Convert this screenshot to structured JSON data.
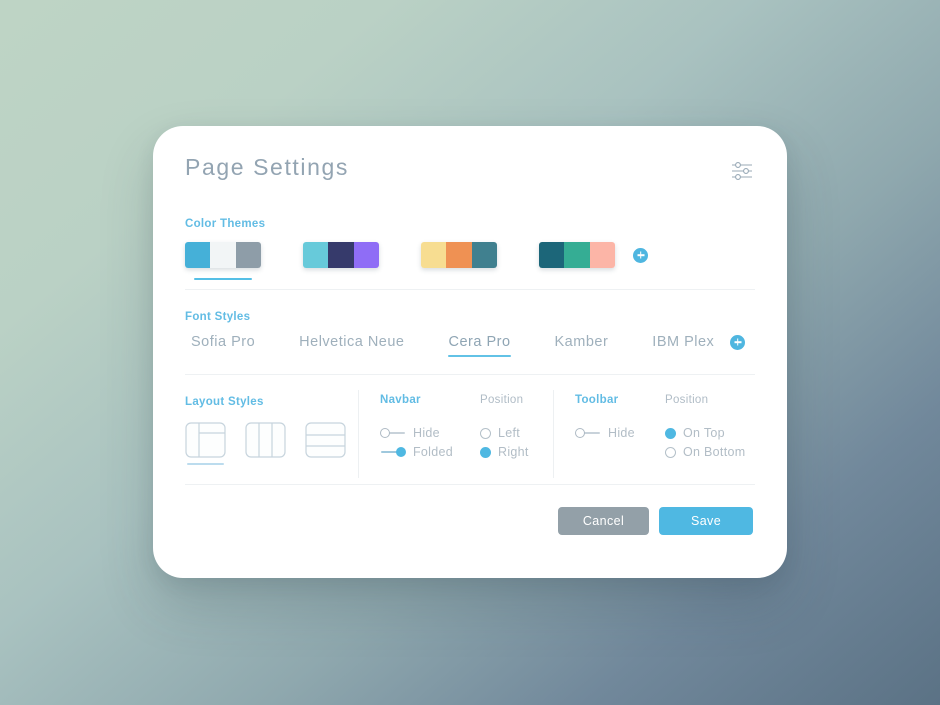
{
  "header": {
    "title": "Page Settings",
    "settings_icon": "sliders-icon"
  },
  "color_themes": {
    "label": "Color Themes",
    "add_label": "+",
    "selected_index": 0,
    "themes": [
      {
        "name": "theme-1",
        "colors": [
          "#45b0d8",
          "#f2f5f6",
          "#8e9da8"
        ]
      },
      {
        "name": "theme-2",
        "colors": [
          "#67cada",
          "#363a6b",
          "#8f6df6"
        ]
      },
      {
        "name": "theme-3",
        "colors": [
          "#f7dd91",
          "#ef9153",
          "#40808f"
        ]
      },
      {
        "name": "theme-4",
        "colors": [
          "#1c6679",
          "#35ad94",
          "#fcb5a7"
        ]
      }
    ]
  },
  "font_styles": {
    "label": "Font Styles",
    "add_label": "+",
    "selected": "Cera Pro",
    "fonts": [
      "Sofia Pro",
      "Helvetica Neue",
      "Cera Pro",
      "Kamber",
      "IBM Plex"
    ]
  },
  "layout_styles": {
    "label": "Layout Styles",
    "selected_index": 0,
    "options": [
      "sidebar-header-layout",
      "three-column-layout",
      "three-row-layout"
    ]
  },
  "navbar": {
    "title": "Navbar",
    "options": [
      {
        "label": "Hide",
        "on": false
      },
      {
        "label": "Folded",
        "on": true
      }
    ],
    "position": {
      "title": "Position",
      "options": [
        {
          "label": "Left",
          "on": false
        },
        {
          "label": "Right",
          "on": true
        }
      ]
    }
  },
  "toolbar": {
    "title": "Toolbar",
    "options": [
      {
        "label": "Hide",
        "on": false
      }
    ],
    "position": {
      "title": "Position",
      "options": [
        {
          "label": "On Top",
          "on": true
        },
        {
          "label": "On Bottom",
          "on": false
        }
      ]
    }
  },
  "footer": {
    "cancel_label": "Cancel",
    "save_label": "Save"
  },
  "colors": {
    "accent": "#4fb8e2",
    "muted_text": "#b2bdc6",
    "title_text": "#93a4b2",
    "cancel_bg": "#93a0a8",
    "bg_top_left": "#bed4c5",
    "bg_bottom_right": "#5b7285"
  }
}
